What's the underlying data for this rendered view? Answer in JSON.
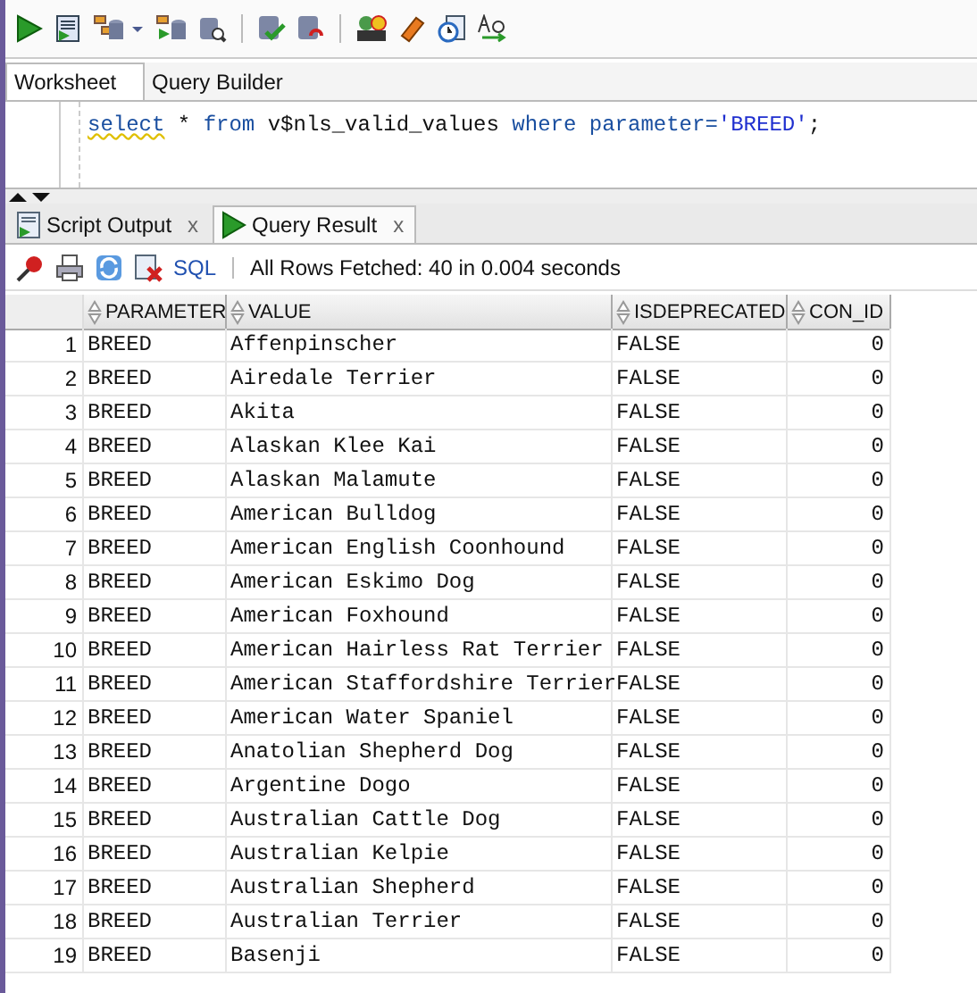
{
  "editor_tabs": [
    {
      "label": "Worksheet",
      "selected": true
    },
    {
      "label": "Query Builder",
      "selected": false
    }
  ],
  "editor": {
    "tokens": [
      {
        "text": "select",
        "kind": "keyword",
        "flagged": true
      },
      {
        "text": " * ",
        "kind": "plain",
        "flagged": false
      },
      {
        "text": "from",
        "kind": "keyword",
        "flagged": false
      },
      {
        "text": " v$nls_valid_values ",
        "kind": "plain",
        "flagged": false
      },
      {
        "text": "where",
        "kind": "keyword",
        "flagged": false
      },
      {
        "text": " parameter=",
        "kind": "keyword",
        "flagged": false
      },
      {
        "text": "'BREED'",
        "kind": "string",
        "flagged": false
      },
      {
        "text": ";",
        "kind": "plain",
        "flagged": false
      }
    ]
  },
  "result_tabs": [
    {
      "label": "Script Output",
      "close": "x",
      "selected": false
    },
    {
      "label": "Query Result",
      "close": "x",
      "selected": true
    }
  ],
  "result_toolbar": {
    "sql_link": "SQL",
    "status": "All Rows Fetched: 40 in 0.004 seconds"
  },
  "grid": {
    "columns": [
      "PARAMETER",
      "VALUE",
      "ISDEPRECATED",
      "CON_ID"
    ],
    "rows": [
      {
        "num": "1",
        "cells": [
          "BREED",
          "Affenpinscher",
          "FALSE",
          "0"
        ]
      },
      {
        "num": "2",
        "cells": [
          "BREED",
          "Airedale Terrier",
          "FALSE",
          "0"
        ]
      },
      {
        "num": "3",
        "cells": [
          "BREED",
          "Akita",
          "FALSE",
          "0"
        ]
      },
      {
        "num": "4",
        "cells": [
          "BREED",
          "Alaskan Klee Kai",
          "FALSE",
          "0"
        ]
      },
      {
        "num": "5",
        "cells": [
          "BREED",
          "Alaskan Malamute",
          "FALSE",
          "0"
        ]
      },
      {
        "num": "6",
        "cells": [
          "BREED",
          "American Bulldog",
          "FALSE",
          "0"
        ]
      },
      {
        "num": "7",
        "cells": [
          "BREED",
          "American English Coonhound",
          "FALSE",
          "0"
        ]
      },
      {
        "num": "8",
        "cells": [
          "BREED",
          "American Eskimo Dog",
          "FALSE",
          "0"
        ]
      },
      {
        "num": "9",
        "cells": [
          "BREED",
          "American Foxhound",
          "FALSE",
          "0"
        ]
      },
      {
        "num": "10",
        "cells": [
          "BREED",
          "American Hairless Rat Terrier",
          "FALSE",
          "0"
        ]
      },
      {
        "num": "11",
        "cells": [
          "BREED",
          "American Staffordshire Terrier",
          "FALSE",
          "0"
        ]
      },
      {
        "num": "12",
        "cells": [
          "BREED",
          "American Water Spaniel",
          "FALSE",
          "0"
        ]
      },
      {
        "num": "13",
        "cells": [
          "BREED",
          "Anatolian Shepherd Dog",
          "FALSE",
          "0"
        ]
      },
      {
        "num": "14",
        "cells": [
          "BREED",
          "Argentine Dogo",
          "FALSE",
          "0"
        ]
      },
      {
        "num": "15",
        "cells": [
          "BREED",
          "Australian Cattle Dog",
          "FALSE",
          "0"
        ]
      },
      {
        "num": "16",
        "cells": [
          "BREED",
          "Australian Kelpie",
          "FALSE",
          "0"
        ]
      },
      {
        "num": "17",
        "cells": [
          "BREED",
          "Australian Shepherd",
          "FALSE",
          "0"
        ]
      },
      {
        "num": "18",
        "cells": [
          "BREED",
          "Australian Terrier",
          "FALSE",
          "0"
        ]
      },
      {
        "num": "19",
        "cells": [
          "BREED",
          "Basenji",
          "FALSE",
          "0"
        ]
      }
    ]
  }
}
